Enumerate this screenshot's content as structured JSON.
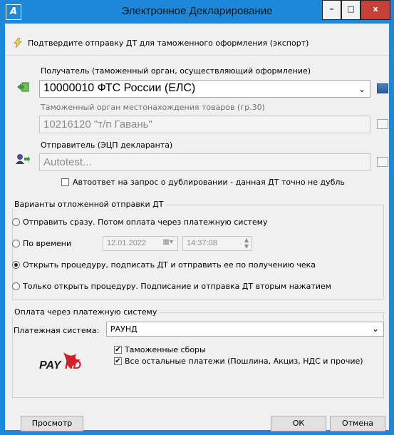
{
  "window": {
    "title": "Электронное Декларирование",
    "minimize": "–",
    "maximize": "□",
    "close": "x"
  },
  "confirm_text": "Подтвердите отправку ДТ для таможенного оформления (экспорт)",
  "receiver": {
    "label": "Получатель (таможенный орган, осуществляющий оформление)",
    "value": "10000010   ФТС России (ЕЛС)"
  },
  "location_customs": {
    "label": "Таможенный орган местонахождения товаров (гр.30)",
    "value": "10216120 \"т/п Гавань\""
  },
  "sender": {
    "label": "Отправитель (ЭЦП декларанта)",
    "value": "Autotest..."
  },
  "auto_reply": {
    "label": "Автоответ на запрос о дублировании - данная ДТ точно не дубль",
    "checked": false
  },
  "deferred": {
    "title": "Варианты отложенной отправки ДТ",
    "options": [
      "Отправить сразу. Потом оплата через платежную систему",
      "По времени",
      "Открыть процедуру, подписать ДТ и отправить ее по получению чека",
      "Только открыть процедуру. Подписание и отправка ДТ вторым нажатием"
    ],
    "selected_index": 2,
    "date": "12.01.2022",
    "time": "14:37:08"
  },
  "payment": {
    "title": "Оплата через платежную систему",
    "system_label": "Платежная система:",
    "system_value": "РАУНД",
    "logo_text_a": "PAY",
    "logo_text_b": "HD",
    "checkbox_customs": "Таможенные сборы",
    "checkbox_other": "Все остальные платежи (Пошлина, Акциз, НДС и прочие)"
  },
  "buttons": {
    "preview": "Просмотр",
    "ok": "ОК",
    "cancel": "Отмена"
  },
  "colors": {
    "titlebar": "#1e88d8",
    "close": "#c8403a",
    "logo_red": "#d0202a"
  }
}
